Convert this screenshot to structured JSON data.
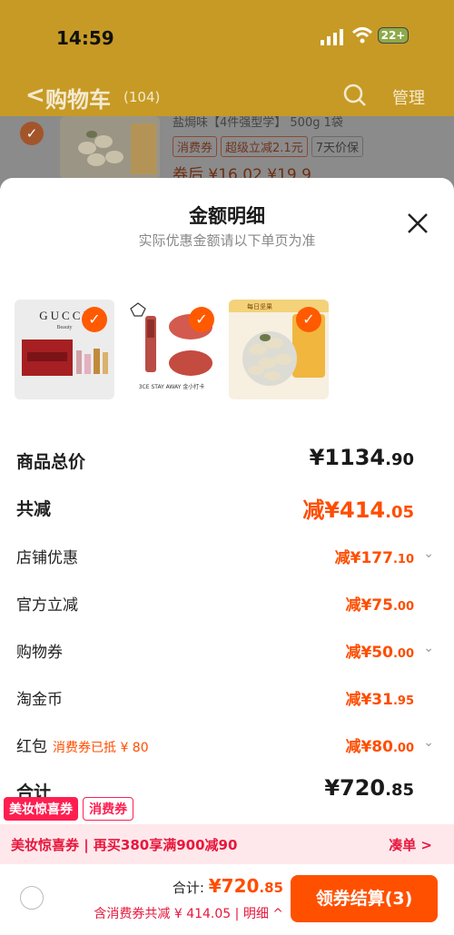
{
  "status_bar": {
    "time": "14:59",
    "battery": "22+"
  },
  "nav": {
    "back_symbol": "<",
    "title": "购物车",
    "count": "(104)",
    "manage": "管理"
  },
  "background_item": {
    "title_fragment": "盐焗味【4件强型学】 500g 1袋",
    "tags": [
      "消费券",
      "超级立减2.1元",
      "7天价保"
    ],
    "price": "券后 ¥16.02  ¥19.9"
  },
  "sheet": {
    "title": "金额明细",
    "subtitle": "实际优惠金额请以下单页为准",
    "products": [
      {
        "name": "gucci-gift-set",
        "brand": "GUCCI",
        "brand_sub": "Beauty"
      },
      {
        "name": "lipstick-set",
        "caption": "3CE STAY AWAY 金小打卡"
      },
      {
        "name": "pumpkin-seeds",
        "caption": "每日坚果"
      }
    ],
    "rows": {
      "subtotal": {
        "label": "商品总价",
        "value_main": "¥1134",
        "value_dec": ".90"
      },
      "total_discount": {
        "label": "共减",
        "value_main": "减¥414",
        "value_dec": ".05"
      },
      "store": {
        "label": "店铺优惠",
        "value_main": "减¥177",
        "value_dec": ".10"
      },
      "official": {
        "label": "官方立减",
        "value_main": "减¥75",
        "value_dec": ".00"
      },
      "coupon": {
        "label": "购物券",
        "value_main": "减¥50",
        "value_dec": ".00"
      },
      "coins": {
        "label": "淘金币",
        "value_main": "减¥31",
        "value_dec": ".95"
      },
      "red_packet": {
        "label": "红包",
        "note": "消费券已抵 ¥ 80",
        "value_main": "减¥80",
        "value_dec": ".00"
      },
      "total": {
        "label": "合计",
        "value_main": "¥720",
        "value_dec": ".85"
      }
    },
    "tags": {
      "tag_a": "美妆惊喜券",
      "tag_b": "消费券"
    },
    "promo": {
      "text": "美妆惊喜券 | 再买380享满900减90",
      "link": "凑单 >"
    },
    "bottom": {
      "sum_label": "合计:",
      "sum_main": "¥720",
      "sum_dec": ".85",
      "sub_text": "含消费券共减 ¥ 414.05 | 明细 ^",
      "checkout": "领券结算(3)"
    }
  },
  "colors": {
    "accent": "#ff5000",
    "promo": "#e8173c",
    "header": "#c79a25"
  }
}
